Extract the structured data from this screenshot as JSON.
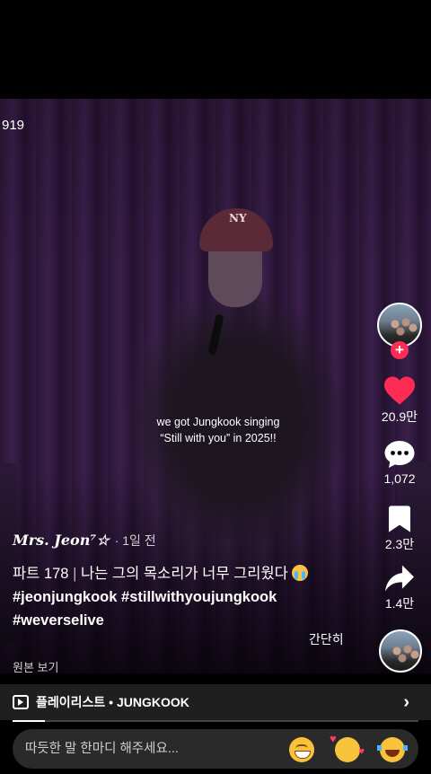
{
  "video": {
    "counter": "919",
    "caption_line1": "we got Jungkook singing",
    "caption_line2": "“Still with you” in 2025!!",
    "cap_logo": "NY"
  },
  "rail": {
    "likes": "20.9만",
    "comments": "1,072",
    "saves": "2.3만",
    "shares": "1.4만",
    "follow_symbol": "+"
  },
  "author": {
    "username": "Mrs. Jeon⁷☆",
    "time": "· 1일 전"
  },
  "description": {
    "part": "파트 178",
    "separator": "|",
    "text": "나는 그의 목소리가 너무 그리웠다",
    "hashtag1": "#jeonjungkook",
    "hashtag2": "#stillwithyoujungkook",
    "hashtag3": "#weverselive"
  },
  "labels": {
    "simple": "간단히",
    "view_original": "원본 보기"
  },
  "playlist": {
    "label": "플레이리스트 • JUNGKOOK",
    "chevron": "›",
    "progress": 0.08
  },
  "comment": {
    "placeholder": "따듯한 말 한마디 해주세요..."
  },
  "icons": {
    "like": "heart-icon",
    "comment": "comment-icon",
    "save": "bookmark-icon",
    "share": "share-icon"
  },
  "colors": {
    "like_red": "#fe2c55",
    "background": "#000000",
    "bar": "#1f1f1f"
  }
}
